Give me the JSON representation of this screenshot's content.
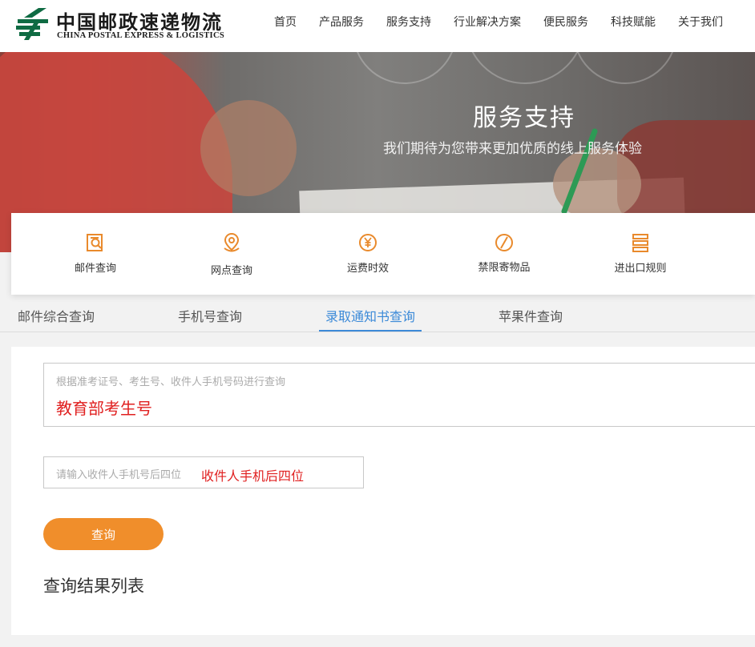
{
  "header": {
    "logo_cn": "中国邮政速递物流",
    "logo_en": "CHINA POSTAL EXPRESS & LOGISTICS",
    "nav": [
      "首页",
      "产品服务",
      "服务支持",
      "行业解决方案",
      "便民服务",
      "科技赋能",
      "关于我们"
    ]
  },
  "banner": {
    "title": "服务支持",
    "subtitle": "我们期待为您带来更加优质的线上服务体验"
  },
  "services": [
    {
      "label": "邮件查询",
      "icon": "mail-search-icon"
    },
    {
      "label": "网点查询",
      "icon": "location-pin-icon"
    },
    {
      "label": "运费时效",
      "icon": "yuan-clock-icon"
    },
    {
      "label": "禁限寄物品",
      "icon": "prohibited-icon"
    },
    {
      "label": "进出口规则",
      "icon": "customs-rule-icon"
    }
  ],
  "tabs": [
    {
      "label": "邮件综合查询",
      "active": false
    },
    {
      "label": "手机号查询",
      "active": false
    },
    {
      "label": "录取通知书查询",
      "active": true
    },
    {
      "label": "苹果件查询",
      "active": false
    }
  ],
  "form": {
    "exam_placeholder": "根据准考证号、考生号、收件人手机号码进行查询",
    "exam_value": "教育部考生号",
    "phone_placeholder": "请输入收件人手机号后四位",
    "phone_value": "收件人手机后四位",
    "query_button": "查询",
    "result_title": "查询结果列表"
  },
  "colors": {
    "accent_green": "#0f6b43",
    "accent_orange": "#f08e2b",
    "tab_active": "#3c8ad8",
    "annotation_red": "#e02020"
  }
}
